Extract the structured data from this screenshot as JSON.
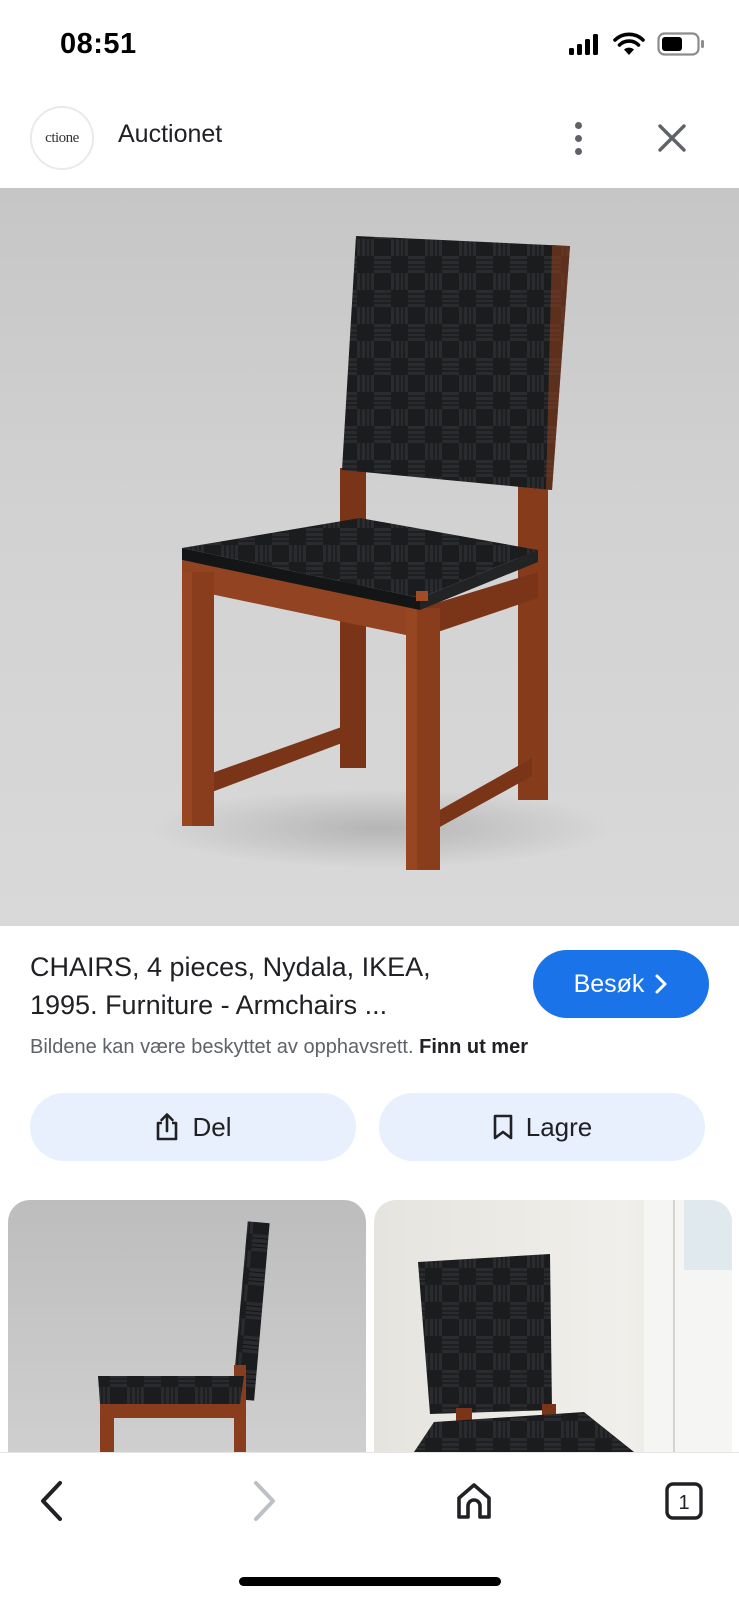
{
  "status_bar": {
    "time": "08:51",
    "battery_level": 0.6
  },
  "header": {
    "logo_text": "ctione",
    "site_name": "Auctionet",
    "more_icon": "more-vert-icon",
    "close_icon": "close-icon"
  },
  "result": {
    "title": "CHAIRS, 4 pieces, Nydala, IKEA, 1995. Furniture - Armchairs ...",
    "visit_label": "Besøk",
    "copyright_text": "Bildene kan være beskyttet av opphavsrett.",
    "learn_more_label": "Finn ut mer"
  },
  "actions": {
    "share_label": "Del",
    "save_label": "Lagre"
  },
  "toolbar": {
    "tab_count": "1"
  },
  "colors": {
    "accent": "#1a73e8",
    "chip_bg": "#e8f0fe",
    "seat_black": "#1b1c1e",
    "wood": "#8a3d1d"
  }
}
